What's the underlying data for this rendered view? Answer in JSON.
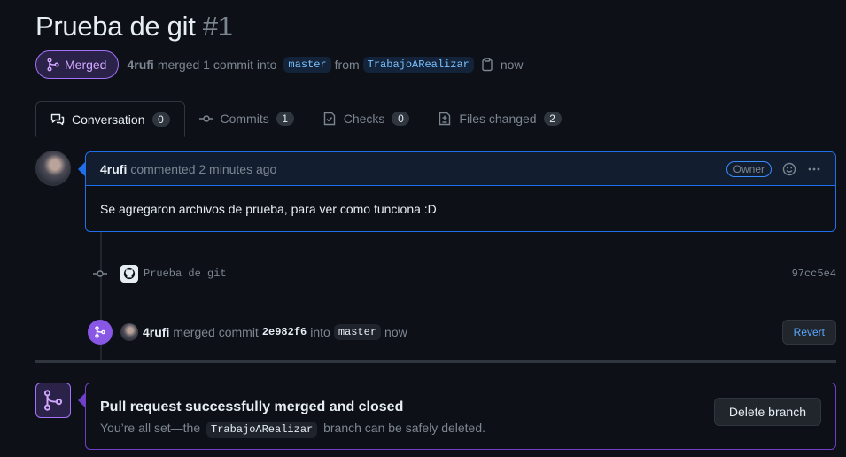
{
  "header": {
    "title": "Prueba de git",
    "number": "#1",
    "status": "Merged",
    "author": "4rufi",
    "action": "merged 1 commit into",
    "base_branch": "master",
    "from_word": "from",
    "head_branch": "TrabajoARealizar",
    "time": "now"
  },
  "tabs": [
    {
      "label": "Conversation",
      "count": "0",
      "icon": "comment-discussion-icon"
    },
    {
      "label": "Commits",
      "count": "1",
      "icon": "git-commit-icon"
    },
    {
      "label": "Checks",
      "count": "0",
      "icon": "checklist-icon"
    },
    {
      "label": "Files changed",
      "count": "2",
      "icon": "file-diff-icon"
    }
  ],
  "comment": {
    "author": "4rufi",
    "meta": "commented 2 minutes ago",
    "role": "Owner",
    "body": "Se agregaron archivos de prueba, para ver como funciona :D"
  },
  "commit": {
    "message": "Prueba de git",
    "sha": "97cc5e4"
  },
  "merge_event": {
    "author": "4rufi",
    "action": "merged commit",
    "sha": "2e982f6",
    "into": "into",
    "branch": "master",
    "time": "now",
    "revert_label": "Revert"
  },
  "merged_box": {
    "title": "Pull request successfully merged and closed",
    "desc_before": "You’re all set—the",
    "branch": "TrabajoARealizar",
    "desc_after": "branch can be safely deleted.",
    "delete_label": "Delete branch"
  },
  "colors": {
    "merged": "#8957e5",
    "accent_blue": "#1f6feb",
    "background": "#0d1117"
  }
}
